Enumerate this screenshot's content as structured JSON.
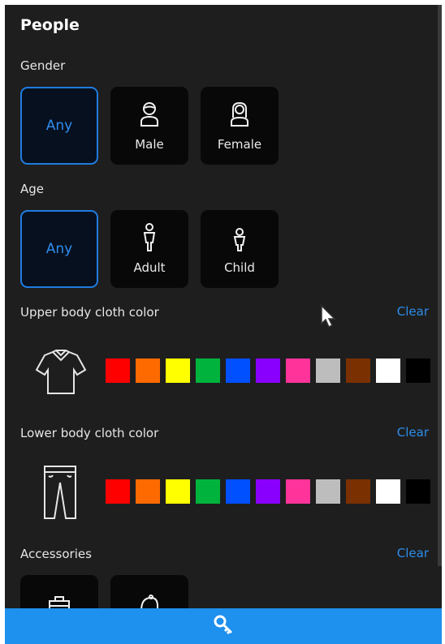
{
  "title": "People",
  "gender": {
    "label": "Gender",
    "options": [
      {
        "label": "Any",
        "selected": true,
        "icon": ""
      },
      {
        "label": "Male",
        "selected": false,
        "icon": "male-person-icon"
      },
      {
        "label": "Female",
        "selected": false,
        "icon": "female-person-icon"
      }
    ]
  },
  "age": {
    "label": "Age",
    "options": [
      {
        "label": "Any",
        "selected": true,
        "icon": ""
      },
      {
        "label": "Adult",
        "selected": false,
        "icon": "adult-person-icon"
      },
      {
        "label": "Child",
        "selected": false,
        "icon": "child-person-icon"
      }
    ]
  },
  "upper_body": {
    "label": "Upper body cloth color",
    "clear": "Clear",
    "icon": "shirt-icon"
  },
  "lower_body": {
    "label": "Lower body cloth color",
    "clear": "Clear",
    "icon": "pants-icon"
  },
  "colors": [
    "#ff0000",
    "#ff6a00",
    "#ffff00",
    "#00b33c",
    "#0050ff",
    "#8a00ff",
    "#ff3399",
    "#bdbdbd",
    "#7a3000",
    "#ffffff",
    "#000000"
  ],
  "accessories": {
    "label": "Accessories",
    "clear": "Clear",
    "items": [
      {
        "icon": "bag-icon"
      },
      {
        "icon": "hat-icon"
      }
    ]
  },
  "search_button": {
    "icon": "search-icon"
  },
  "theme": {
    "accent": "#1e90ee",
    "panel_bg": "#1e1e1f",
    "tile_bg": "#080809"
  }
}
